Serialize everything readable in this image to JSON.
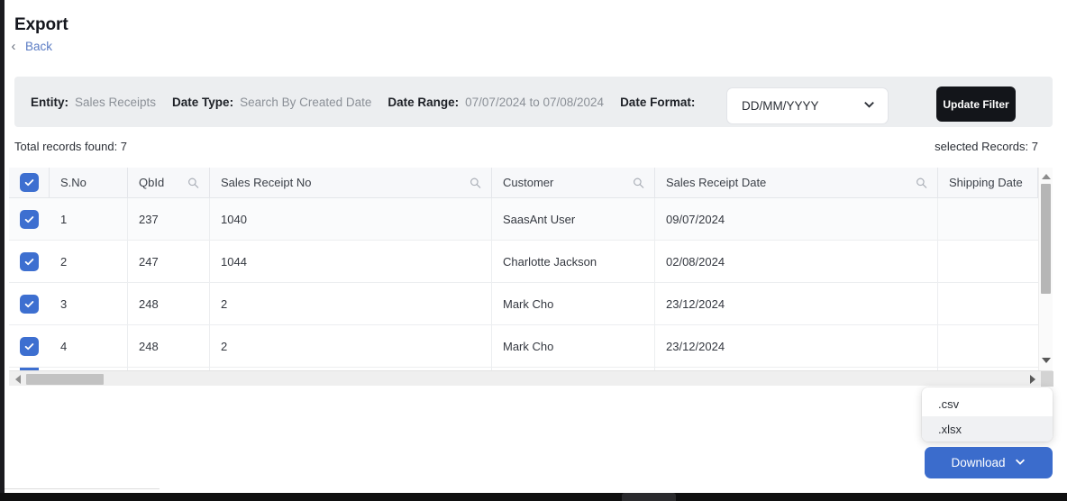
{
  "header": {
    "title": "Export",
    "back_label": "Back",
    "back_icon": "chevron-left-icon"
  },
  "filter_bar": {
    "entity_label": "Entity:",
    "entity_value": "Sales Receipts",
    "date_type_label": "Date Type:",
    "date_type_value": "Search By Created Date",
    "date_range_label": "Date Range:",
    "date_range_value": "07/07/2024 to 07/08/2024",
    "date_format_label": "Date Format:",
    "date_format_value": "DD/MM/YYYY",
    "date_format_icon": "chevron-down-icon",
    "update_filter_label": "Update Filter",
    "background_color": "#eceef0",
    "update_filter_color": "#13151a"
  },
  "counts": {
    "total_records": "Total records found: 7",
    "selected_records": "selected Records: 7"
  },
  "table": {
    "select_all_checked": true,
    "checkbox_color": "#3d6fd0",
    "search_icon": "search-icon",
    "columns": [
      {
        "key": "sno",
        "label": "S.No",
        "searchable": false
      },
      {
        "key": "qbid",
        "label": "QbId",
        "searchable": true
      },
      {
        "key": "srno",
        "label": "Sales Receipt No",
        "searchable": true
      },
      {
        "key": "cust",
        "label": "Customer",
        "searchable": true
      },
      {
        "key": "srdate",
        "label": "Sales Receipt Date",
        "searchable": true
      },
      {
        "key": "ship",
        "label": "Shipping Date",
        "searchable": false
      }
    ],
    "rows": [
      {
        "checked": true,
        "sno": "1",
        "qbid": "237",
        "srno": "1040",
        "cust": "SaasAnt User",
        "srdate": "09/07/2024",
        "ship": ""
      },
      {
        "checked": true,
        "sno": "2",
        "qbid": "247",
        "srno": "1044",
        "cust": "Charlotte Jackson",
        "srdate": "02/08/2024",
        "ship": ""
      },
      {
        "checked": true,
        "sno": "3",
        "qbid": "248",
        "srno": "2",
        "cust": "Mark Cho",
        "srdate": "23/12/2024",
        "ship": ""
      },
      {
        "checked": true,
        "sno": "4",
        "qbid": "248",
        "srno": "2",
        "cust": "Mark Cho",
        "srdate": "23/12/2024",
        "ship": ""
      }
    ],
    "vertical_scrollbar": {
      "up_icon": "triangle-up-icon",
      "down_icon": "triangle-down-icon"
    },
    "horizontal_scrollbar": {
      "left_icon": "triangle-left-icon",
      "right_icon": "triangle-right-icon"
    }
  },
  "format_menu": {
    "items": [
      {
        "label": ".csv",
        "active": false
      },
      {
        "label": ".xlsx",
        "active": true
      }
    ]
  },
  "download": {
    "label": "Download",
    "icon": "chevron-down-icon",
    "color": "#3b6ccc"
  }
}
